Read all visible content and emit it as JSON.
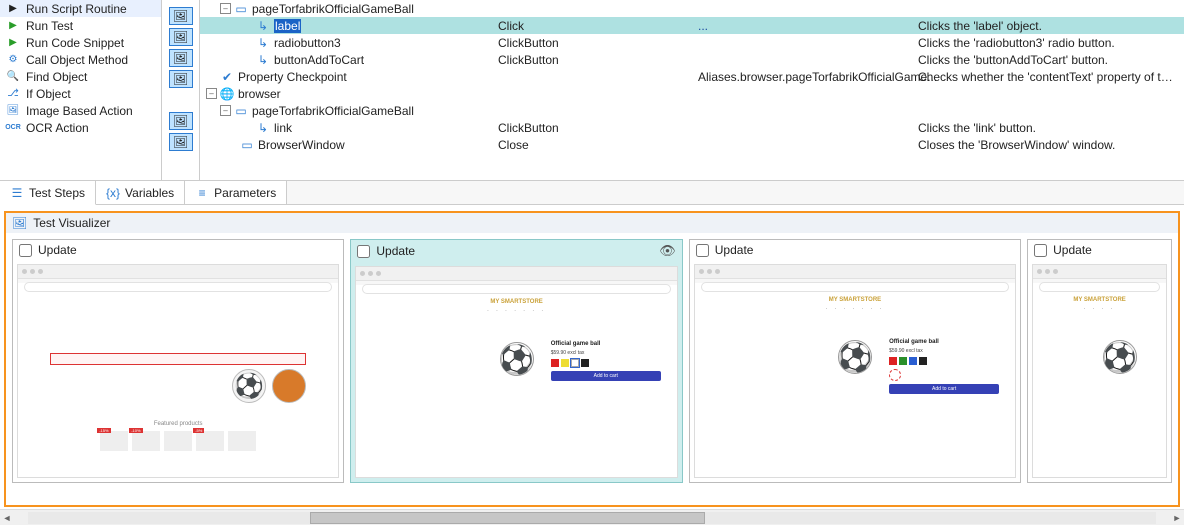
{
  "actions": {
    "runScriptRoutine": "Run Script Routine",
    "runTest": "Run Test",
    "runCodeSnippet": "Run Code Snippet",
    "callObjectMethod": "Call Object Method",
    "findObject": "Find Object",
    "ifObject": "If Object",
    "imageBasedAction": "Image Based Action",
    "ocrAction": "OCR Action"
  },
  "tree": {
    "r0": {
      "name": "pageTorfabrikOfficialGameBall"
    },
    "r1": {
      "name": "label",
      "op": "Click",
      "val": "...",
      "desc": "Clicks the 'label' object."
    },
    "r2": {
      "name": "radiobutton3",
      "op": "ClickButton",
      "desc": "Clicks the 'radiobutton3' radio button."
    },
    "r3": {
      "name": "buttonAddToCart",
      "op": "ClickButton",
      "desc": "Clicks the 'buttonAddToCart' button."
    },
    "r4": {
      "name": "Property Checkpoint",
      "val": "Aliases.browser.pageTorfabrikOfficialGame...",
      "desc": "Checks whether the 'contentText' property of the Ali..."
    },
    "r5": {
      "name": "browser"
    },
    "r6": {
      "name": "pageTorfabrikOfficialGameBall"
    },
    "r7": {
      "name": "link",
      "op": "ClickButton",
      "desc": "Clicks the 'link' button."
    },
    "r8": {
      "name": "BrowserWindow",
      "op": "Close",
      "desc": "Closes the 'BrowserWindow' window."
    }
  },
  "tabs": {
    "testSteps": "Test Steps",
    "variables": "Variables",
    "parameters": "Parameters"
  },
  "visualizer": {
    "title": "Test Visualizer",
    "update": "Update"
  },
  "product": {
    "title": "Official game ball",
    "price": "$59.90 excl tax",
    "addToCart": "Add to cart",
    "logo": "MY SMARTSTORE"
  }
}
